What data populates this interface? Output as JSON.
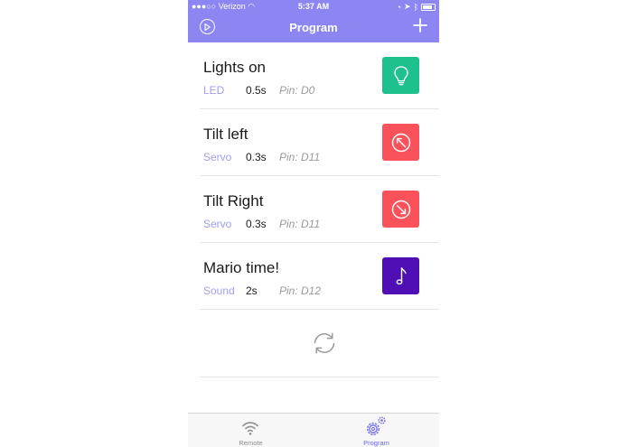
{
  "status_bar": {
    "carrier": "Verizon",
    "time": "5:37 AM"
  },
  "nav": {
    "title": "Program",
    "play_icon": "play-circle-icon",
    "add_icon": "plus-icon"
  },
  "program": {
    "items": [
      {
        "title": "Lights on",
        "type": "LED",
        "duration": "0.5s",
        "pin": "Pin: D0",
        "icon": "lightbulb-icon",
        "color": "#1ec08e"
      },
      {
        "title": "Tilt left",
        "type": "Servo",
        "duration": "0.3s",
        "pin": "Pin: D11",
        "icon": "arrow-up-left-circle-icon",
        "color": "#f9525a"
      },
      {
        "title": "Tilt Right",
        "type": "Servo",
        "duration": "0.3s",
        "pin": "Pin: D11",
        "icon": "arrow-down-right-circle-icon",
        "color": "#f9525a"
      },
      {
        "title": "Mario time!",
        "type": "Sound",
        "duration": "2s",
        "pin": "Pin: D12",
        "icon": "music-note-icon",
        "color": "#4f0fb5"
      }
    ]
  },
  "tabs": [
    {
      "label": "Remote",
      "icon": "wifi-icon"
    },
    {
      "label": "Program",
      "icon": "gears-icon"
    }
  ],
  "colors": {
    "accent": "#8b86f2",
    "type_text": "#a19ef0",
    "active_tab": "#6a66e8"
  }
}
